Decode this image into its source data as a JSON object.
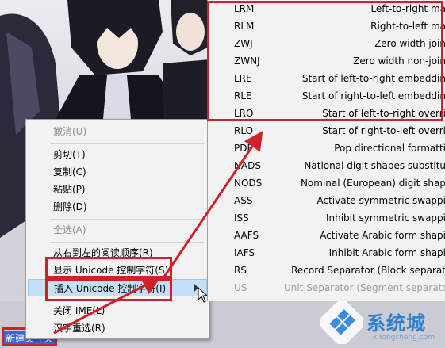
{
  "desktop": {
    "selected_label": "新建文件夹"
  },
  "context_menu": {
    "items": [
      {
        "label": "撤消(U)",
        "disabled": true
      },
      {
        "label": "剪切(T)",
        "disabled": false
      },
      {
        "label": "复制(C)",
        "disabled": false
      },
      {
        "label": "粘贴(P)",
        "disabled": false
      },
      {
        "label": "删除(D)",
        "disabled": false
      },
      {
        "label": "全选(A)",
        "disabled": true
      },
      {
        "label": "从右到左的阅读顺序(R)",
        "disabled": false
      },
      {
        "label": "显示 Unicode 控制字符(S)",
        "disabled": false
      },
      {
        "label": "插入 Unicode 控制字符(I)",
        "disabled": false,
        "highlighted": true,
        "has_submenu": true
      },
      {
        "label": "关闭 IME(L)",
        "disabled": false
      },
      {
        "label": "汉字重选(R)",
        "disabled": false
      }
    ]
  },
  "submenu": {
    "items": [
      {
        "code": "LRM",
        "desc": "Left-to-right ma"
      },
      {
        "code": "RLM",
        "desc": "Right-to-left ma"
      },
      {
        "code": "ZWJ",
        "desc": "Zero width join"
      },
      {
        "code": "ZWNJ",
        "desc": "Zero width non-join"
      },
      {
        "code": "LRE",
        "desc": "Start of left-to-right embeddin"
      },
      {
        "code": "RLE",
        "desc": "Start of right-to-left embeddin"
      },
      {
        "code": "LRO",
        "desc": "Start of left-to-right overri"
      },
      {
        "code": "RLO",
        "desc": "Start of right-to-left overri"
      },
      {
        "code": "PDF",
        "desc": "Pop directional formatti"
      },
      {
        "code": "NADS",
        "desc": "National digit shapes substitu"
      },
      {
        "code": "NODS",
        "desc": "Nominal (European) digit shap"
      },
      {
        "code": "ASS",
        "desc": "Activate symmetric swappi"
      },
      {
        "code": "ISS",
        "desc": "Inhibit symmetric swappi"
      },
      {
        "code": "AAFS",
        "desc": "Activate Arabic form shapi"
      },
      {
        "code": "IAFS",
        "desc": "Inhibit Arabic form shapi"
      },
      {
        "code": "RS",
        "desc": "Record Separator (Block separat"
      },
      {
        "code": "US",
        "desc": "Unit Separator (Segment separato"
      }
    ]
  },
  "watermark": {
    "name": "系统城",
    "url": "xitongcheng.com"
  },
  "colors": {
    "annotation_red": "#d0202a",
    "menu_bg": "#f2f2f2",
    "highlight_bg": "#c4dff6",
    "selection_blue": "#3a66d2",
    "watermark_blue": "#2f7fd0"
  },
  "icons": [
    "windows-logo-icon",
    "cursor-arrow-icon",
    "submenu-arrow-icon"
  ]
}
